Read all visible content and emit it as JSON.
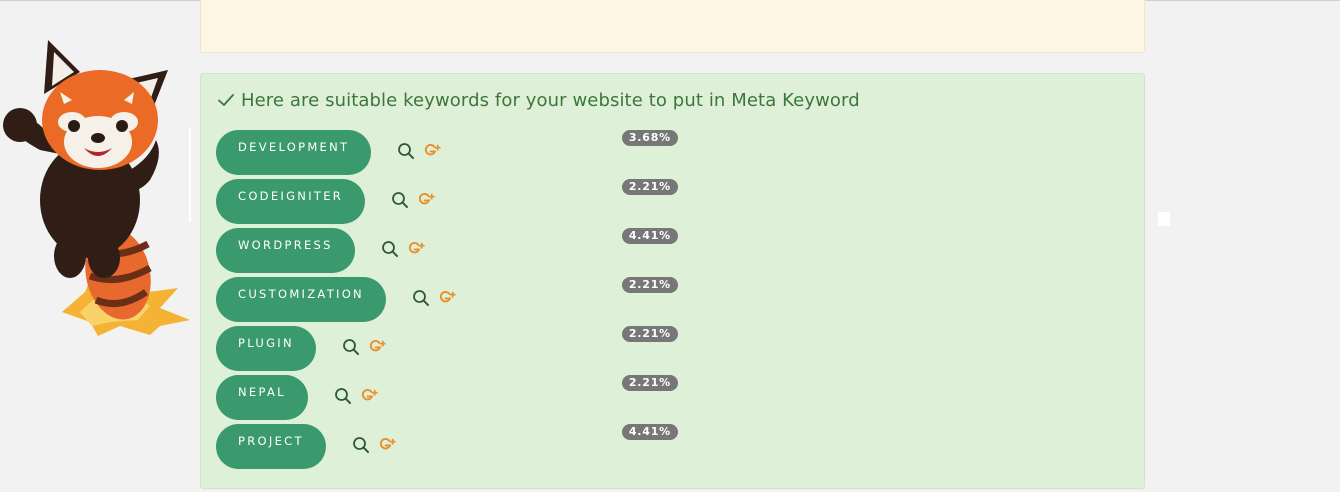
{
  "result": {
    "message": "Here are suitable keywords for your website to put in Meta Keyword",
    "accent_color": "#3a9a6d",
    "text_color": "#3c763d",
    "keywords": [
      {
        "label": "DEVELOPMENT",
        "percent": "3.68%"
      },
      {
        "label": "CODEIGNITER",
        "percent": "2.21%"
      },
      {
        "label": "WORDPRESS",
        "percent": "4.41%"
      },
      {
        "label": "CUSTOMIZATION",
        "percent": "2.21%"
      },
      {
        "label": "PLUGIN",
        "percent": "2.21%"
      },
      {
        "label": "NEPAL",
        "percent": "2.21%"
      },
      {
        "label": "PROJECT",
        "percent": "4.41%"
      }
    ]
  },
  "icons": {
    "heading": "check-icon",
    "row_actions": [
      "search-icon",
      "google-plus-icon"
    ],
    "mascot": "red-panda-mascot"
  }
}
